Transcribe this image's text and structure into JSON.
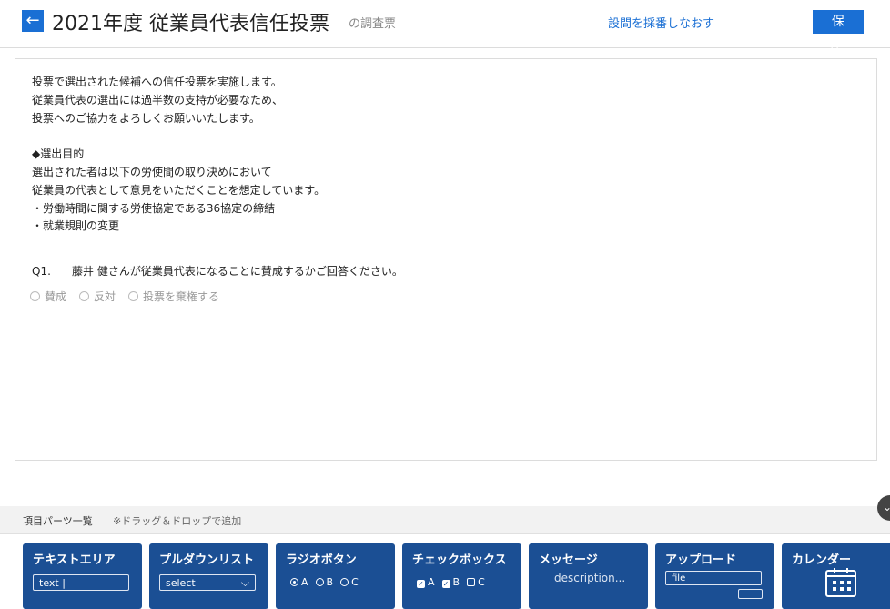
{
  "header": {
    "back_icon": "←",
    "title": "2021年度 従業員代表信任投票",
    "subtitle": "の調査票",
    "reselect_link": "設問を採番しなおす",
    "save_label": "保 存",
    "accent_color": "#1a6fd4"
  },
  "form": {
    "intro_lines": [
      "投票で選出された候補への信任投票を実施します。",
      "従業員代表の選出には過半数の支持が必要なため、",
      "投票へのご協力をよろしくお願いいたします。",
      "",
      "◆選出目的",
      "選出された者は以下の労使間の取り決めにおいて",
      "従業員の代表として意見をいただくことを想定しています。",
      "・労働時間に関する労使協定である36協定の締結",
      "・就業規則の変更"
    ],
    "question": {
      "number": "Q1.",
      "text": "藤井 健さんが従業員代表になることに賛成するかご回答ください。",
      "options": [
        "賛成",
        "反対",
        "投票を棄権する"
      ]
    }
  },
  "parts_bar": {
    "title": "項目パーツ一覧",
    "note": "※ドラッグ＆ドロップで追加",
    "collapse_icon": "chevron-down-icon"
  },
  "parts": {
    "card_color": "#1b4f94",
    "textarea": {
      "label": "テキストエリア",
      "sample": "text |"
    },
    "pulldown": {
      "label": "プルダウンリスト",
      "sample": "select",
      "arrow": "⌵"
    },
    "radio": {
      "label": "ラジオボタン",
      "options": [
        "A",
        "B",
        "C"
      ]
    },
    "checkbox": {
      "label": "チェックボックス",
      "options": [
        "A",
        "B",
        "C"
      ]
    },
    "message": {
      "label": "メッセージ",
      "sample": "description..."
    },
    "upload": {
      "label": "アップロード",
      "sample": "file"
    },
    "calendar": {
      "label": "カレンダー",
      "icon": "calendar-icon"
    }
  }
}
